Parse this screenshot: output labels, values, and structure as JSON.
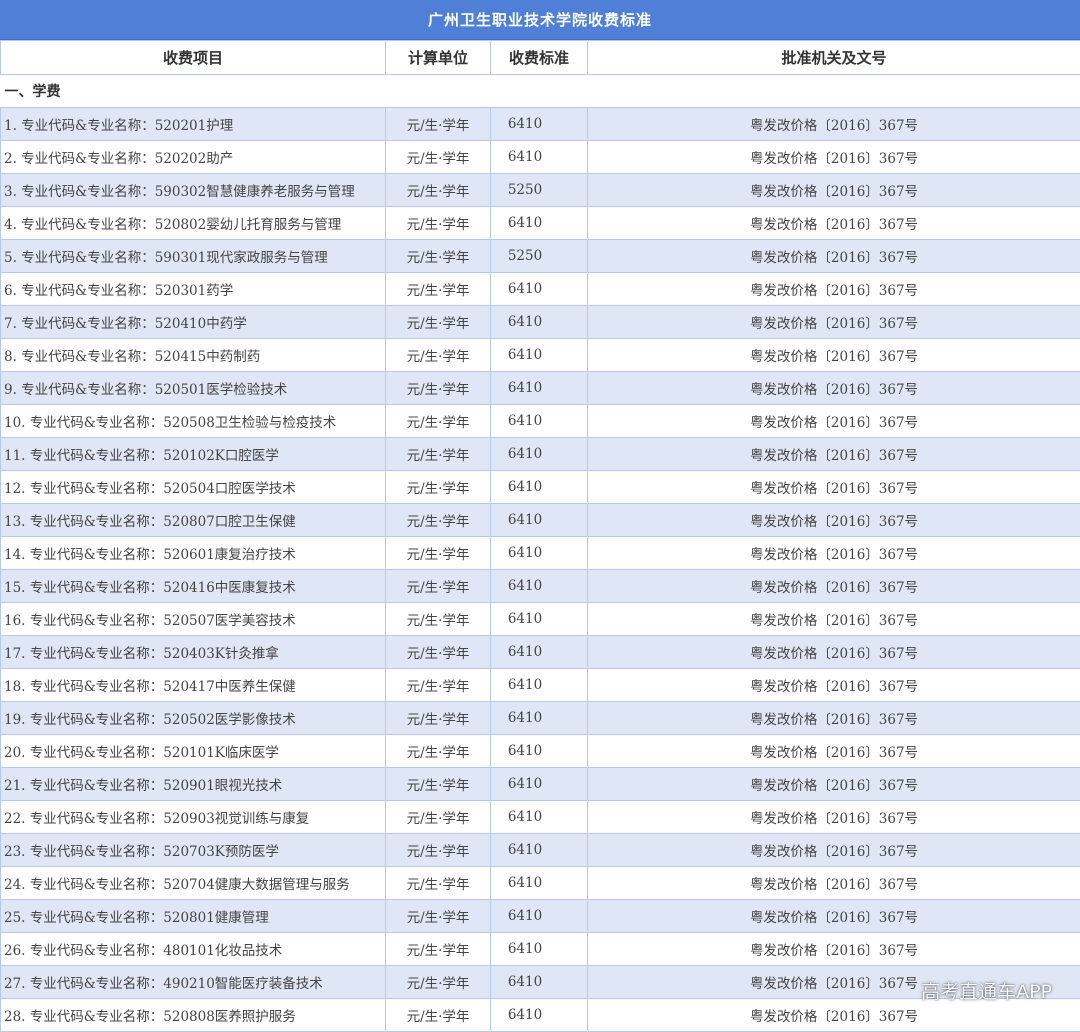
{
  "title": "广州卫生职业技术学院收费标准",
  "headers": {
    "item": "收费项目",
    "unit": "计算单位",
    "standard": "收费标准",
    "authority": "批准机关及文号"
  },
  "section_title": "一、学费",
  "rows": [
    {
      "name": "1. 专业代码&专业名称：520201护理",
      "unit": "元/生·学年",
      "fee": "6410",
      "doc": "粤发改价格〔2016〕367号"
    },
    {
      "name": "2. 专业代码&专业名称：520202助产",
      "unit": "元/生·学年",
      "fee": "6410",
      "doc": "粤发改价格〔2016〕367号"
    },
    {
      "name": "3. 专业代码&专业名称：590302智慧健康养老服务与管理",
      "unit": "元/生·学年",
      "fee": "5250",
      "doc": "粤发改价格〔2016〕367号"
    },
    {
      "name": "4. 专业代码&专业名称：520802婴幼儿托育服务与管理",
      "unit": "元/生·学年",
      "fee": "6410",
      "doc": "粤发改价格〔2016〕367号"
    },
    {
      "name": "5. 专业代码&专业名称：590301现代家政服务与管理",
      "unit": "元/生·学年",
      "fee": "5250",
      "doc": "粤发改价格〔2016〕367号"
    },
    {
      "name": "6. 专业代码&专业名称：520301药学",
      "unit": "元/生·学年",
      "fee": "6410",
      "doc": "粤发改价格〔2016〕367号"
    },
    {
      "name": "7. 专业代码&专业名称：520410中药学",
      "unit": "元/生·学年",
      "fee": "6410",
      "doc": "粤发改价格〔2016〕367号"
    },
    {
      "name": "8. 专业代码&专业名称：520415中药制药",
      "unit": "元/生·学年",
      "fee": "6410",
      "doc": "粤发改价格〔2016〕367号"
    },
    {
      "name": "9. 专业代码&专业名称：520501医学检验技术",
      "unit": "元/生·学年",
      "fee": "6410",
      "doc": "粤发改价格〔2016〕367号"
    },
    {
      "name": "10. 专业代码&专业名称：520508卫生检验与检疫技术",
      "unit": "元/生·学年",
      "fee": "6410",
      "doc": "粤发改价格〔2016〕367号"
    },
    {
      "name": "11. 专业代码&专业名称：520102K口腔医学",
      "unit": "元/生·学年",
      "fee": "6410",
      "doc": "粤发改价格〔2016〕367号"
    },
    {
      "name": "12. 专业代码&专业名称：520504口腔医学技术",
      "unit": "元/生·学年",
      "fee": "6410",
      "doc": "粤发改价格〔2016〕367号"
    },
    {
      "name": "13. 专业代码&专业名称：520807口腔卫生保健",
      "unit": "元/生·学年",
      "fee": "6410",
      "doc": "粤发改价格〔2016〕367号"
    },
    {
      "name": "14. 专业代码&专业名称：520601康复治疗技术",
      "unit": "元/生·学年",
      "fee": "6410",
      "doc": "粤发改价格〔2016〕367号"
    },
    {
      "name": "15. 专业代码&专业名称：520416中医康复技术",
      "unit": "元/生·学年",
      "fee": "6410",
      "doc": "粤发改价格〔2016〕367号"
    },
    {
      "name": "16. 专业代码&专业名称：520507医学美容技术",
      "unit": "元/生·学年",
      "fee": "6410",
      "doc": "粤发改价格〔2016〕367号"
    },
    {
      "name": "17. 专业代码&专业名称：520403K针灸推拿",
      "unit": "元/生·学年",
      "fee": "6410",
      "doc": "粤发改价格〔2016〕367号"
    },
    {
      "name": "18. 专业代码&专业名称：520417中医养生保健",
      "unit": "元/生·学年",
      "fee": "6410",
      "doc": "粤发改价格〔2016〕367号"
    },
    {
      "name": "19. 专业代码&专业名称：520502医学影像技术",
      "unit": "元/生·学年",
      "fee": "6410",
      "doc": "粤发改价格〔2016〕367号"
    },
    {
      "name": "20. 专业代码&专业名称：520101K临床医学",
      "unit": "元/生·学年",
      "fee": "6410",
      "doc": "粤发改价格〔2016〕367号"
    },
    {
      "name": "21. 专业代码&专业名称：520901眼视光技术",
      "unit": "元/生·学年",
      "fee": "6410",
      "doc": "粤发改价格〔2016〕367号"
    },
    {
      "name": "22. 专业代码&专业名称：520903视觉训练与康复",
      "unit": "元/生·学年",
      "fee": "6410",
      "doc": "粤发改价格〔2016〕367号"
    },
    {
      "name": "23. 专业代码&专业名称：520703K预防医学",
      "unit": "元/生·学年",
      "fee": "6410",
      "doc": "粤发改价格〔2016〕367号"
    },
    {
      "name": "24. 专业代码&专业名称：520704健康大数据管理与服务",
      "unit": "元/生·学年",
      "fee": "6410",
      "doc": "粤发改价格〔2016〕367号"
    },
    {
      "name": "25. 专业代码&专业名称：520801健康管理",
      "unit": "元/生·学年",
      "fee": "6410",
      "doc": "粤发改价格〔2016〕367号"
    },
    {
      "name": "26. 专业代码&专业名称：480101化妆品技术",
      "unit": "元/生·学年",
      "fee": "6410",
      "doc": "粤发改价格〔2016〕367号"
    },
    {
      "name": "27. 专业代码&专业名称：490210智能医疗装备技术",
      "unit": "元/生·学年",
      "fee": "6410",
      "doc": "粤发改价格〔2016〕367号"
    },
    {
      "name": "28. 专业代码&专业名称：520808医养照护服务",
      "unit": "元/生·学年",
      "fee": "6410",
      "doc": "粤发改价格〔2016〕367号"
    }
  ],
  "watermark": "高考直通车APP",
  "colors": {
    "title_bg": "#4f7fd6",
    "alt_row_bg": "#dfe6f5",
    "border": "#b8c8e8"
  }
}
